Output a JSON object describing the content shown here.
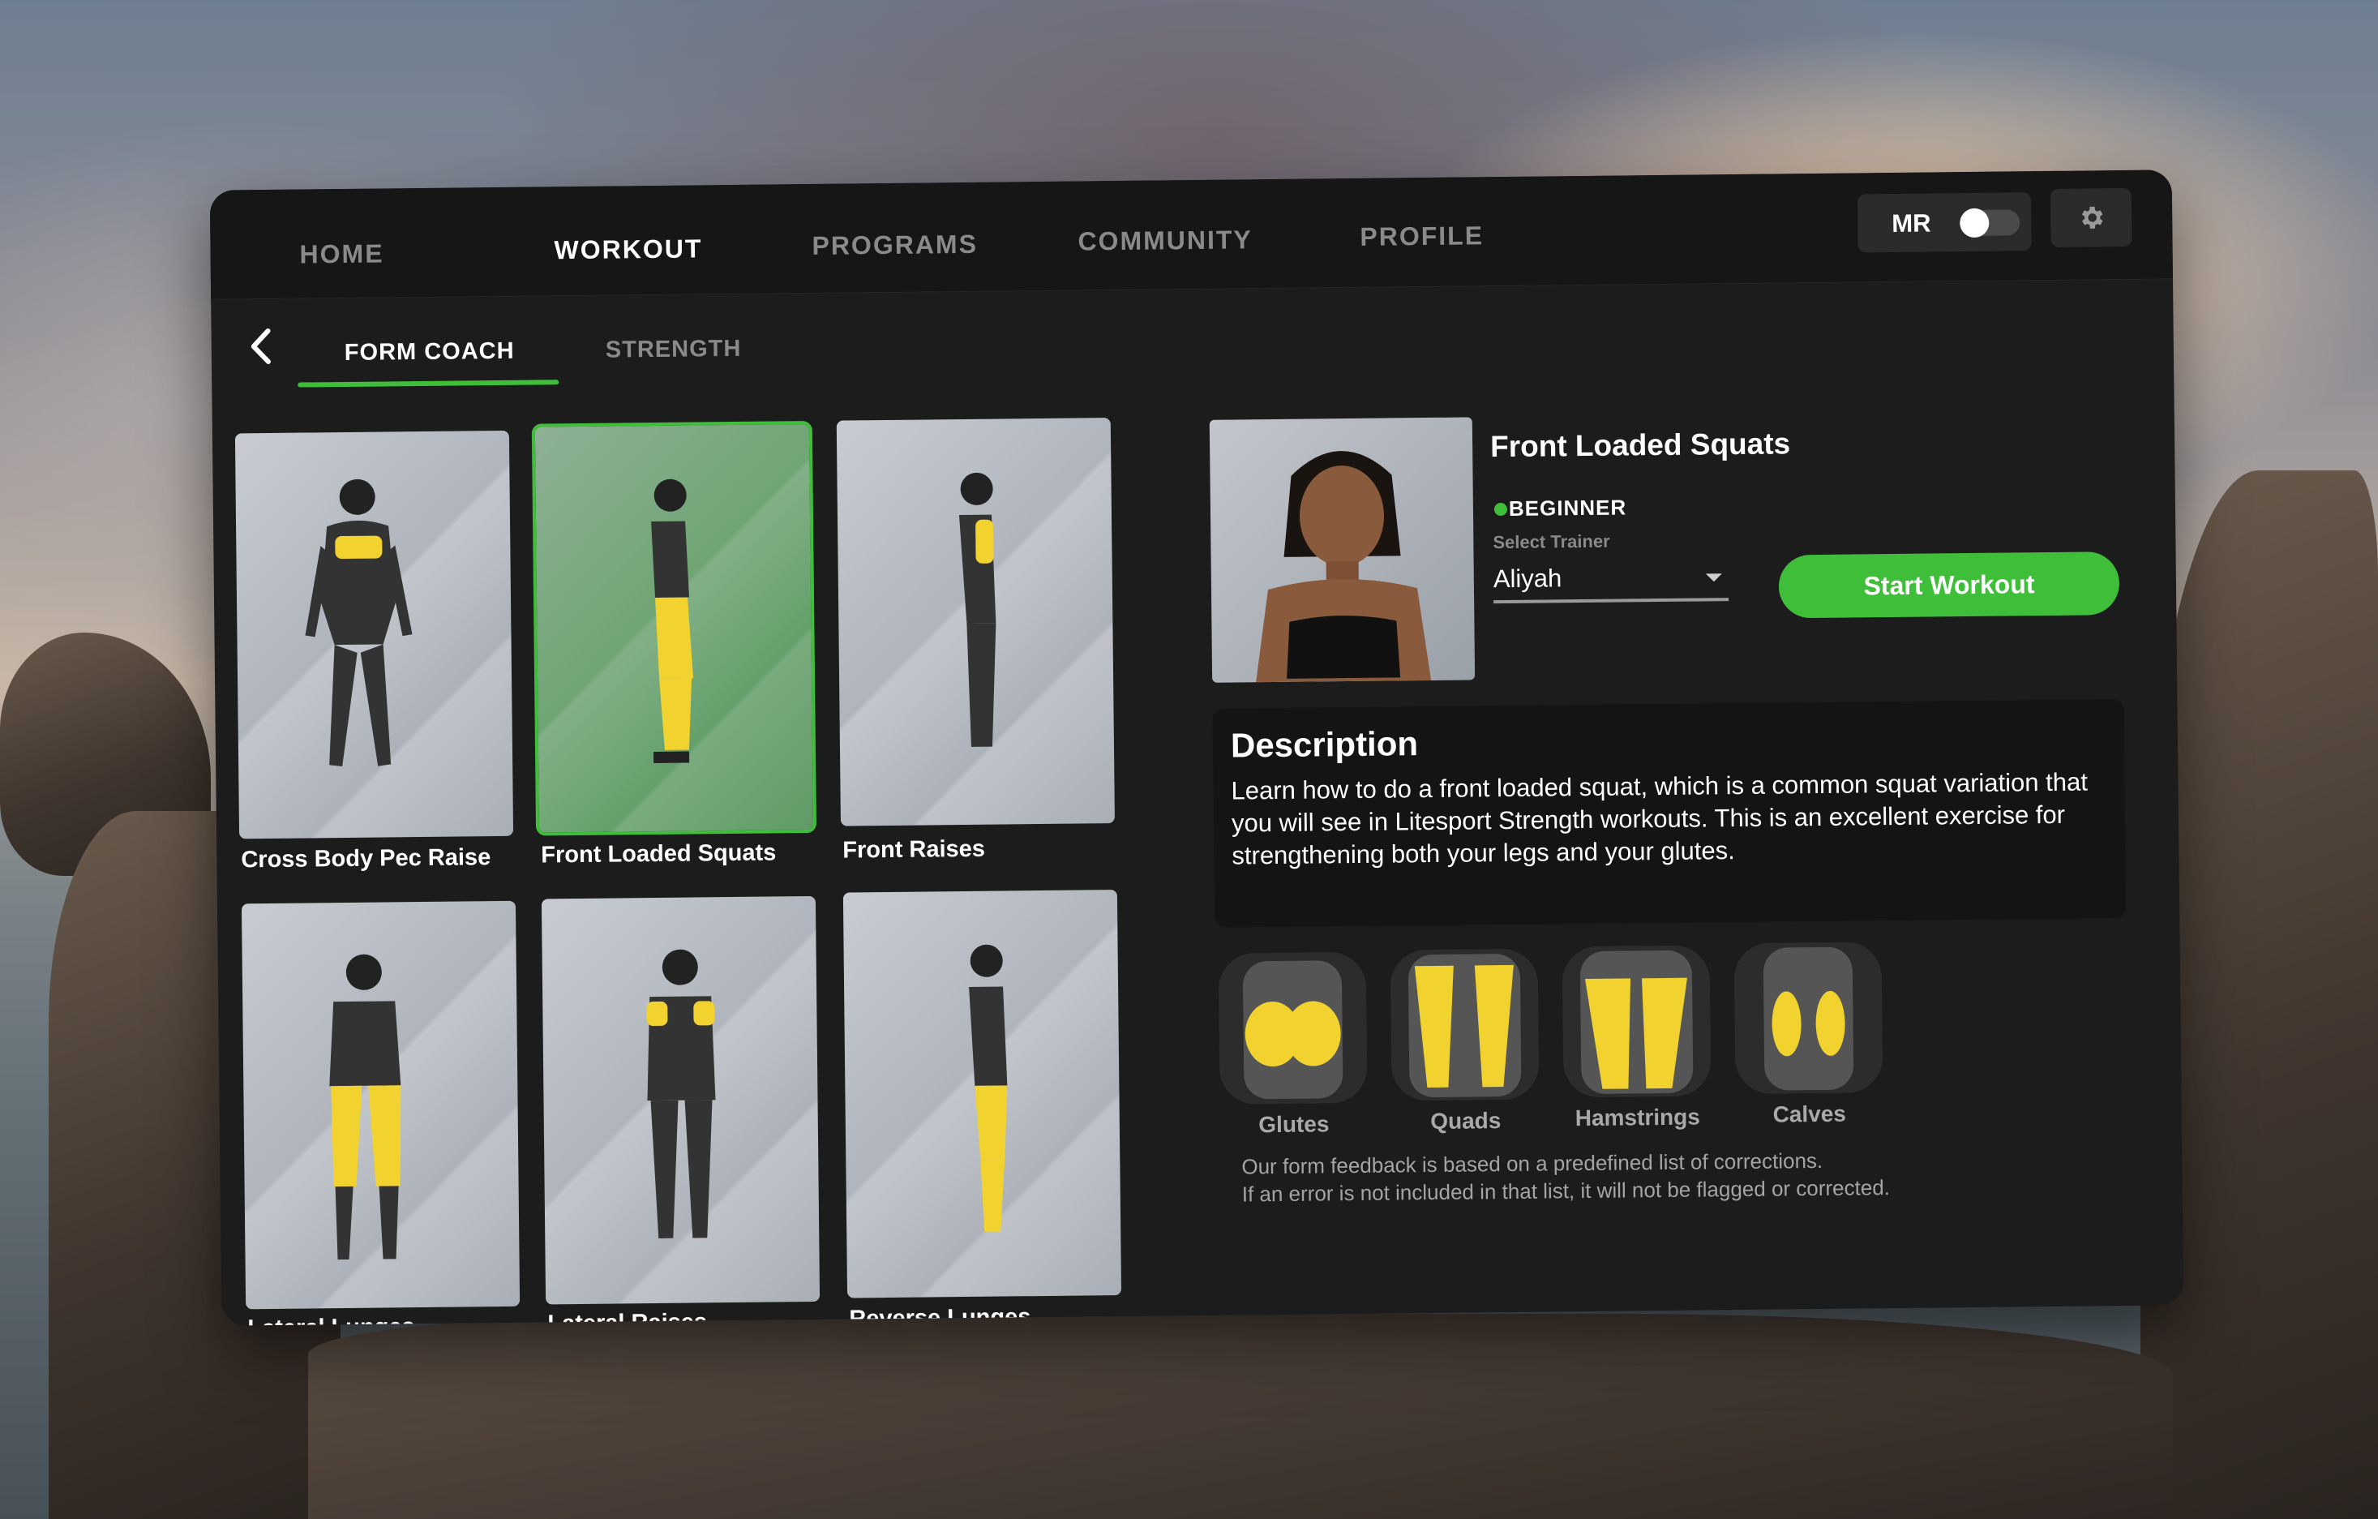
{
  "nav": {
    "items": [
      {
        "label": "HOME"
      },
      {
        "label": "WORKOUT"
      },
      {
        "label": "PROGRAMS"
      },
      {
        "label": "COMMUNITY"
      },
      {
        "label": "PROFILE"
      }
    ],
    "active_index": 1,
    "mr_label": "MR",
    "mr_enabled": false,
    "settings_icon": "gear-icon"
  },
  "subnav": {
    "back_icon": "chevron-left-icon",
    "tabs": [
      {
        "label": "FORM COACH"
      },
      {
        "label": "STRENGTH"
      }
    ],
    "active_index": 0
  },
  "exercises": [
    {
      "label": "Cross Body Pec Raise",
      "selected": false
    },
    {
      "label": "Front Loaded Squats",
      "selected": true
    },
    {
      "label": "Front Raises",
      "selected": false
    },
    {
      "label": "Lateral Lunges",
      "selected": false
    },
    {
      "label": "Lateral Raises",
      "selected": false
    },
    {
      "label": "Reverse Lunges",
      "selected": false
    }
  ],
  "detail": {
    "title": "Front Loaded Squats",
    "level": "BEGINNER",
    "trainer_label": "Select Trainer",
    "trainer_value": "Aliyah",
    "start_label": "Start Workout",
    "description_title": "Description",
    "description": "Learn how to do a front loaded squat, which is a common squat variation that you will see in Litesport Strength workouts. This is an excellent exercise for strengthening both your legs and your glutes.",
    "muscles": [
      {
        "label": "Glutes"
      },
      {
        "label": "Quads"
      },
      {
        "label": "Hamstrings"
      },
      {
        "label": "Calves"
      }
    ],
    "note_line1": "Our form feedback is based on a predefined list of corrections.",
    "note_line2": "If an error is not included in that list, it will not be flagged or corrected."
  },
  "colors": {
    "accent": "#3fbe3a",
    "highlight": "#f2d22e",
    "panel": "#1c1c1c"
  }
}
